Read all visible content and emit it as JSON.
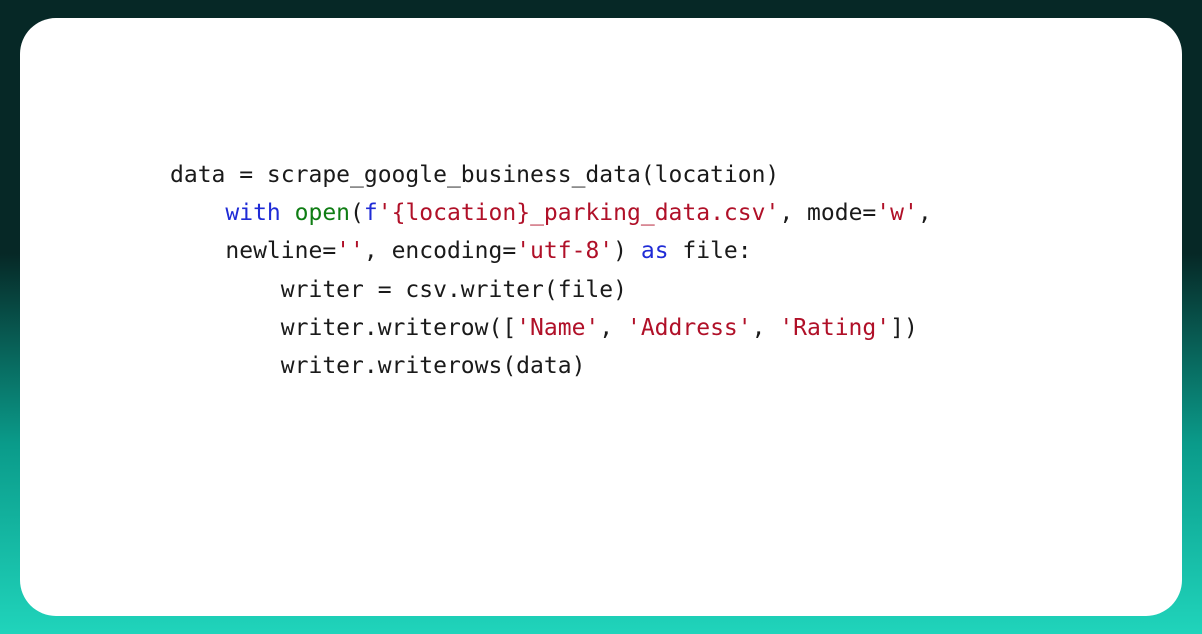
{
  "code": {
    "line1": {
      "text": "data = scrape_google_business_data(location)"
    },
    "line2": {
      "indent": "    ",
      "kw_with": "with",
      "sp1": " ",
      "fn_open": "open",
      "paren": "(",
      "fpre": "f",
      "str1": "'{location}_parking_data.csv'",
      "mid": ", mode=",
      "str2": "'w'",
      "tail": ","
    },
    "line3": {
      "indent": "    ",
      "lead": "newline=",
      "str1": "''",
      "mid": ", encoding=",
      "str2": "'utf-8'",
      "close": ") ",
      "kw_as": "as",
      "tail": " file:"
    },
    "line4": {
      "text": "        writer = csv.writer(file)"
    },
    "line5": {
      "indent": "        ",
      "lead": "writer.writerow([",
      "s1": "'Name'",
      "c1": ", ",
      "s2": "'Address'",
      "c2": ", ",
      "s3": "'Rating'",
      "tail": "])"
    },
    "line6": {
      "text": "        writer.writerows(data)"
    }
  }
}
